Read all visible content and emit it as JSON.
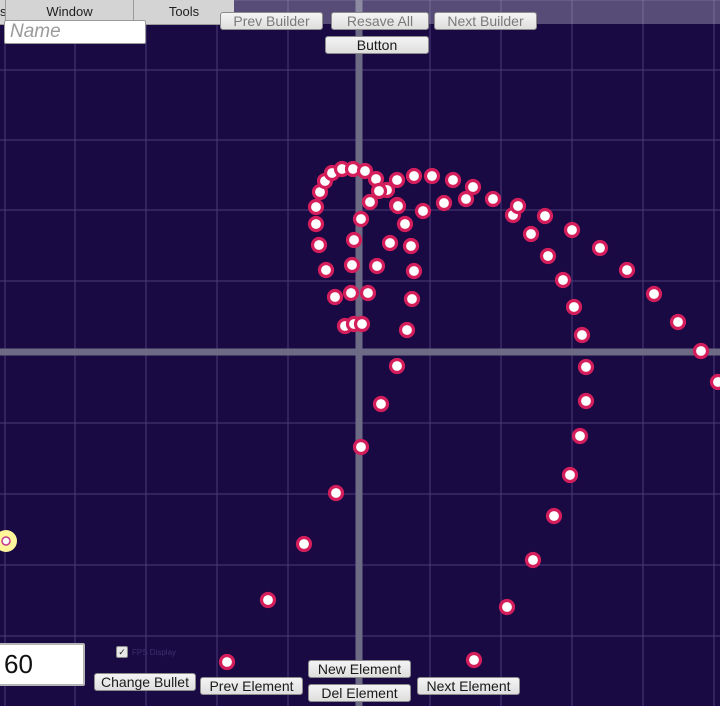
{
  "menu": {
    "items": [
      {
        "label": "s"
      },
      {
        "label": "Window"
      },
      {
        "label": "Tools"
      }
    ]
  },
  "toolbar": {
    "prev_builder": "Prev Builder",
    "resave_all": "Resave All",
    "next_builder": "Next Builder",
    "button": "Button"
  },
  "name_field": {
    "placeholder": "Name",
    "value": ""
  },
  "value_field": {
    "value": "60"
  },
  "fps_toggle": {
    "label": "FPS Display",
    "checked": true
  },
  "bottom_controls": {
    "change_bullet": "Change Bullet",
    "prev_element": "Prev Element",
    "new_element": "New Element",
    "del_element": "Del Element",
    "next_element": "Next Element"
  },
  "icons": {
    "check": "check-icon",
    "emitter": "emitter-icon"
  },
  "colors": {
    "background": "#1a0a44",
    "grid": "#4a3c78",
    "axis": "#6d6a86",
    "bullet_outline": "#d41e5c",
    "bullet_fill": "#ffffff",
    "emitter_outer": "#fff59a",
    "emitter_inner": "#ffffff",
    "emitter_ring": "#c43a8c"
  }
}
